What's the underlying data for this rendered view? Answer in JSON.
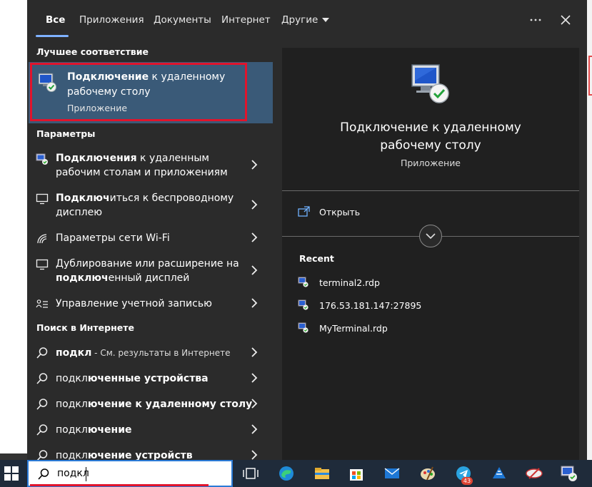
{
  "tabs": [
    {
      "label": "Все"
    },
    {
      "label": "Приложения"
    },
    {
      "label": "Документы"
    },
    {
      "label": "Интернет"
    },
    {
      "label": "Другие"
    }
  ],
  "best_match": {
    "header": "Лучшее соответствие",
    "title_bold": "Подключение",
    "title_rest": " к удаленному рабочему столу",
    "subtitle": "Приложение"
  },
  "settings": {
    "header": "Параметры",
    "items": [
      {
        "bold": "Подключения",
        "rest": " к удаленным рабочим столам и приложениям",
        "icon": "remote-desktop-icon"
      },
      {
        "bold": "Подключ",
        "rest": "иться к беспроводному дисплею",
        "icon": "monitor-icon"
      },
      {
        "bold": "",
        "rest": "Параметры сети Wi-Fi",
        "icon": "wifi-icon"
      },
      {
        "pre": "Дублирование или расширение на ",
        "bold": "подключ",
        "rest": "енный дисплей",
        "icon": "monitor-icon"
      },
      {
        "bold": "",
        "rest": "Управление учетной записью",
        "icon": "account-list-icon"
      }
    ]
  },
  "web": {
    "header": "Поиск в Интернете",
    "items": [
      {
        "bold": "подкл",
        "rest": " - См. результаты в Интернете"
      },
      {
        "bold": "подкл",
        "rest": "юченные устройства"
      },
      {
        "bold": "подкл",
        "rest": "ючение к удаленному столу"
      },
      {
        "bold": "подкл",
        "rest": "ючение"
      },
      {
        "bold": "подкл",
        "rest": "ючение устройств"
      }
    ]
  },
  "preview": {
    "title": "Подключение к удаленному рабочему столу",
    "subtitle": "Приложение",
    "open_label": "Открыть",
    "recent_header": "Recent",
    "recent": [
      "terminal2.rdp",
      "176.53.181.147:27895",
      "MyTerminal.rdp"
    ]
  },
  "search": {
    "query": "подкл"
  },
  "taskbar": {
    "telegram_badge": "43"
  },
  "colors": {
    "accent": "#3a5a78",
    "highlight_border": "#e0142c",
    "tab_underline": "#7fb2ff",
    "panel": "#2b2b2b",
    "preview_panel": "#202020"
  }
}
